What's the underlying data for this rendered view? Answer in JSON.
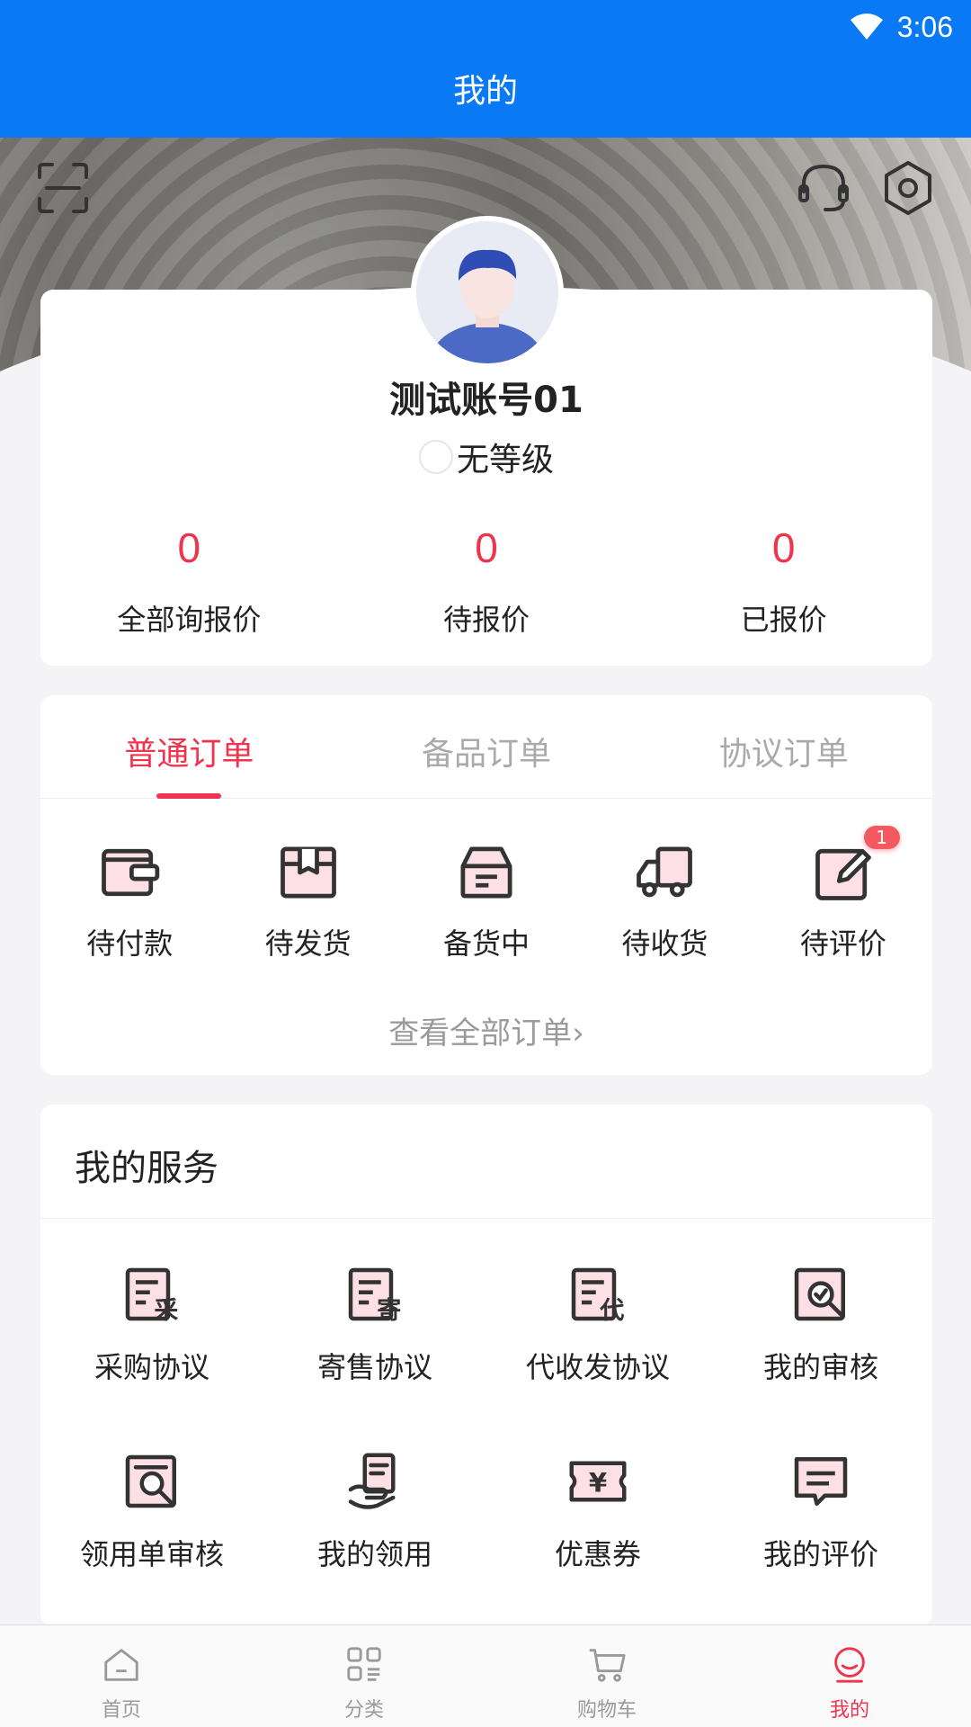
{
  "status_bar": {
    "time": "3:06",
    "wifi_icon": "wifi-icon"
  },
  "header": {
    "title": "我的"
  },
  "hero": {
    "scan_icon": "scan-icon",
    "support_icon": "headset-icon",
    "settings_icon": "gear-icon"
  },
  "profile": {
    "username": "测试账号01",
    "level": "无等级",
    "stats": [
      {
        "value": "0",
        "label": "全部询报价"
      },
      {
        "value": "0",
        "label": "待报价"
      },
      {
        "value": "0",
        "label": "已报价"
      }
    ]
  },
  "orders": {
    "tabs": [
      {
        "label": "普通订单",
        "active": true
      },
      {
        "label": "备品订单",
        "active": false
      },
      {
        "label": "协议订单",
        "active": false
      }
    ],
    "items": [
      {
        "label": "待付款",
        "icon": "wallet-icon"
      },
      {
        "label": "待发货",
        "icon": "box-icon"
      },
      {
        "label": "备货中",
        "icon": "inbox-icon"
      },
      {
        "label": "待收货",
        "icon": "truck-icon"
      },
      {
        "label": "待评价",
        "icon": "edit-icon",
        "badge": "1"
      }
    ],
    "view_all": "查看全部订单"
  },
  "services": {
    "title": "我的服务",
    "items": [
      {
        "label": "采购协议",
        "icon": "purchase-doc-icon",
        "glyph": "采"
      },
      {
        "label": "寄售协议",
        "icon": "consign-doc-icon",
        "glyph": "寄"
      },
      {
        "label": "代收发协议",
        "icon": "agent-doc-icon",
        "glyph": "代"
      },
      {
        "label": "我的审核",
        "icon": "review-icon"
      },
      {
        "label": "领用单审核",
        "icon": "requisition-review-icon"
      },
      {
        "label": "我的领用",
        "icon": "hand-doc-icon"
      },
      {
        "label": "优惠券",
        "icon": "coupon-icon",
        "glyph": "¥"
      },
      {
        "label": "我的评价",
        "icon": "comment-icon"
      }
    ]
  },
  "bottom_nav": [
    {
      "label": "首页",
      "icon": "home-icon"
    },
    {
      "label": "分类",
      "icon": "category-icon"
    },
    {
      "label": "购物车",
      "icon": "cart-icon"
    },
    {
      "label": "我的",
      "icon": "user-icon",
      "active": true
    }
  ],
  "colors": {
    "primary": "#0a79f5",
    "accent": "#f0344e",
    "icon_fill": "#fde0e6"
  }
}
